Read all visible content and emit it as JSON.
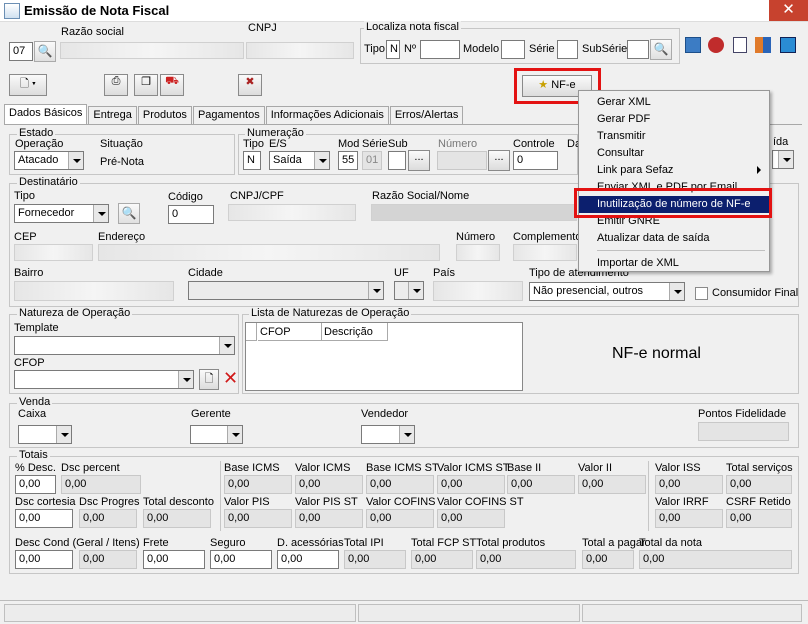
{
  "window": {
    "title": "Emissão de Nota Fiscal",
    "close": "✕"
  },
  "header": {
    "empresa_code": "07",
    "razao_label": "Razão social",
    "cnpj_label": "CNPJ",
    "localiza_title": "Localiza nota fiscal",
    "tipo_label": "Tipo",
    "tipo_value": "N",
    "no_label": "Nº",
    "modelo_label": "Modelo",
    "serie_label": "Série",
    "subserie_label": "SubSérie"
  },
  "toolbar": {
    "nfe_button": "NF-e"
  },
  "tabs": [
    "Dados Básicos",
    "Entrega",
    "Produtos",
    "Pagamentos",
    "Informações Adicionais",
    "Erros/Alertas"
  ],
  "estado": {
    "title": "Estado",
    "operacao_label": "Operação",
    "operacao_value": "Atacado",
    "situacao_label": "Situação",
    "situacao_value": "Pré-Nota"
  },
  "numeracao": {
    "title": "Numeração",
    "tipo_label": "Tipo",
    "tipo_value": "N",
    "es_label": "E/S",
    "es_value": "Saída",
    "mod_label": "Mod",
    "mod_value": "55",
    "serie_label": "Série",
    "serie_value": "01",
    "sub_label": "Sub",
    "numero_label": "Número",
    "controle_label": "Controle",
    "controle_value": "0",
    "da_label": "Da",
    "saida_label": "ída",
    "ellipsis": "..."
  },
  "destinatario": {
    "title": "Destinatário",
    "tipo_label": "Tipo",
    "tipo_value": "Fornecedor",
    "codigo_label": "Código",
    "codigo_value": "0",
    "cnpjcpf_label": "CNPJ/CPF",
    "razao_label": "Razão Social/Nome",
    "cep_label": "CEP",
    "endereco_label": "Endereço",
    "numero_label": "Número",
    "complemento_label": "Complemento",
    "bairro_label": "Bairro",
    "cidade_label": "Cidade",
    "uf_label": "UF",
    "pais_label": "País",
    "atendimento_label": "Tipo de atendimento",
    "atendimento_value": "Não presencial, outros",
    "consumidor_label": "Consumidor Final"
  },
  "natureza": {
    "title": "Natureza de Operação",
    "template_label": "Template",
    "cfop_label": "CFOP"
  },
  "lista": {
    "title": "Lista de Naturezas de Operação",
    "columns": [
      "CFOP",
      "Descrição"
    ],
    "status": "NF-e normal"
  },
  "venda": {
    "title": "Venda",
    "caixa_label": "Caixa",
    "gerente_label": "Gerente",
    "vendedor_label": "Vendedor",
    "pontos_label": "Pontos Fidelidade"
  },
  "totais": {
    "title": "Totais",
    "row1": [
      {
        "l": "% Desc.",
        "v": "0,00"
      },
      {
        "l": "Dsc percent",
        "v": "0,00"
      },
      {
        "l": "Base ICMS",
        "v": "0,00"
      },
      {
        "l": "Valor ICMS",
        "v": "0,00"
      },
      {
        "l": "Base ICMS ST",
        "v": "0,00"
      },
      {
        "l": "Valor ICMS ST",
        "v": "0,00"
      },
      {
        "l": "Base II",
        "v": "0,00"
      },
      {
        "l": "Valor II",
        "v": "0,00"
      },
      {
        "l": "Valor ISS",
        "v": "0,00"
      },
      {
        "l": "Total serviços",
        "v": "0,00"
      }
    ],
    "row2": [
      {
        "l": "Dsc cortesia",
        "v": "0,00"
      },
      {
        "l": "Dsc Progres",
        "v": "0,00"
      },
      {
        "l": "Total desconto",
        "v": "0,00"
      },
      {
        "l": "Valor PIS",
        "v": "0,00"
      },
      {
        "l": "Valor PIS ST",
        "v": "0,00"
      },
      {
        "l": "Valor COFINS",
        "v": "0,00"
      },
      {
        "l": "Valor COFINS ST",
        "v": "0,00"
      },
      {
        "l": "Valor IRRF",
        "v": "0,00"
      },
      {
        "l": "CSRF Retido",
        "v": "0,00"
      }
    ],
    "row3": [
      {
        "l": "Desc Cond (Geral / Itens)",
        "v": "0,00"
      },
      {
        "l": "",
        "v": "0,00"
      },
      {
        "l": "Frete",
        "v": "0,00"
      },
      {
        "l": "Seguro",
        "v": "0,00"
      },
      {
        "l": "D. acessórias",
        "v": "0,00"
      },
      {
        "l": "Total IPI",
        "v": "0,00"
      },
      {
        "l": "Total FCP ST",
        "v": "0,00"
      },
      {
        "l": "Total produtos",
        "v": "0,00"
      },
      {
        "l": "Total a pagar",
        "v": "0,00"
      },
      {
        "l": "Total da nota",
        "v": "0,00"
      }
    ]
  },
  "menu": {
    "items": [
      "Gerar XML",
      "Gerar PDF",
      "Transmitir",
      "Consultar",
      "Link para Sefaz",
      "Enviar XML e PDF por Email",
      "Inutilização de número de NF-e",
      "Emitir GNRE",
      "Atualizar data de saída",
      "Importar de XML"
    ]
  }
}
